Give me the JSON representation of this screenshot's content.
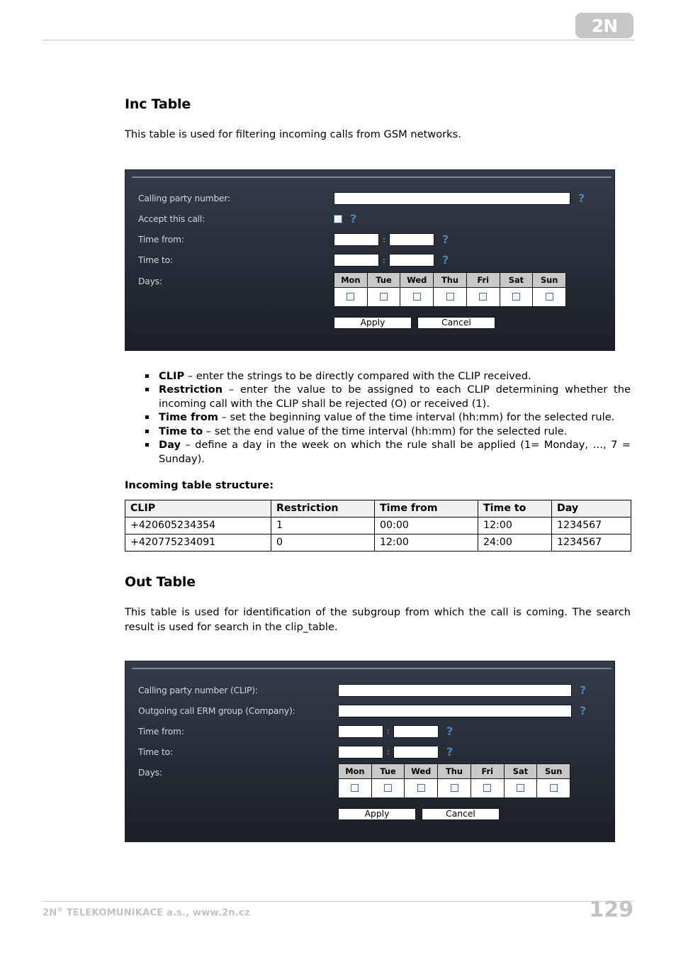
{
  "header": {
    "logo_text": "2N"
  },
  "sections": {
    "inc": {
      "title": "Inc Table",
      "intro": "This table is used for filtering incoming calls from GSM networks.",
      "dialog": {
        "rows": [
          {
            "label": "Calling party number:",
            "type": "text"
          },
          {
            "label": "Accept this call:",
            "type": "checkbox"
          },
          {
            "label": "Time from:",
            "type": "time"
          },
          {
            "label": "Time to:",
            "type": "time"
          },
          {
            "label": "Days:",
            "type": "days"
          }
        ],
        "time_separator": ":",
        "help_glyph": "?",
        "days": [
          "Mon",
          "Tue",
          "Wed",
          "Thu",
          "Fri",
          "Sat",
          "Sun"
        ],
        "apply_label": "Apply",
        "cancel_label": "Cancel"
      },
      "bullets": [
        {
          "term": "CLIP",
          "text": " – enter the strings to be directly compared with the CLIP received."
        },
        {
          "term": "Restriction",
          "text": " – enter the value to be assigned to each CLIP determining whether the incoming call with the CLIP shall be rejected (O) or received (1)."
        },
        {
          "term": "Time from",
          "text": " – set the beginning value of the time interval (hh:mm) for the selected rule."
        },
        {
          "term": "Time to",
          "text": " – set the end value of the time interval (hh:mm) for the selected rule."
        },
        {
          "term": "Day",
          "text": " – define a day in the week on which the rule shall be applied (1= Monday, …, 7 = Sunday)."
        }
      ],
      "table_caption": "Incoming table structure:",
      "table": {
        "columns": [
          "CLIP",
          "Restriction",
          "Time from",
          "Time to",
          "Day"
        ],
        "rows": [
          [
            "+420605234354",
            "1",
            "00:00",
            "12:00",
            "1234567"
          ],
          [
            "+420775234091",
            "0",
            "12:00",
            "24:00",
            "1234567"
          ]
        ]
      }
    },
    "out": {
      "title": "Out Table",
      "intro": "This table is used for identification of the subgroup from which the call is coming. The search result is used for search in the clip_table.",
      "dialog": {
        "rows": [
          {
            "label": "Calling party number (CLIP):",
            "type": "text"
          },
          {
            "label": "Outgoing call ERM group (Company):",
            "type": "text"
          },
          {
            "label": "Time from:",
            "type": "time"
          },
          {
            "label": "Time to:",
            "type": "time"
          },
          {
            "label": "Days:",
            "type": "days"
          }
        ],
        "time_separator": ":",
        "help_glyph": "?",
        "days": [
          "Mon",
          "Tue",
          "Wed",
          "Thu",
          "Fri",
          "Sat",
          "Sun"
        ],
        "apply_label": "Apply",
        "cancel_label": "Cancel"
      }
    }
  },
  "footer": {
    "company": "2N",
    "registered_mark": "®",
    "company_rest": " TELEKOMUNIKACE a.s., www.2n.cz",
    "page_number": "129"
  },
  "colors": {
    "panel_top": "#343c49",
    "panel_bottom": "#1b1f26",
    "panel_label": "#d2d6db",
    "help_blue": "#4f81b4",
    "days_header": "#c8c8c8",
    "footer_grey": "#c3c3c3",
    "rule_grey": "#bfbfbf"
  }
}
